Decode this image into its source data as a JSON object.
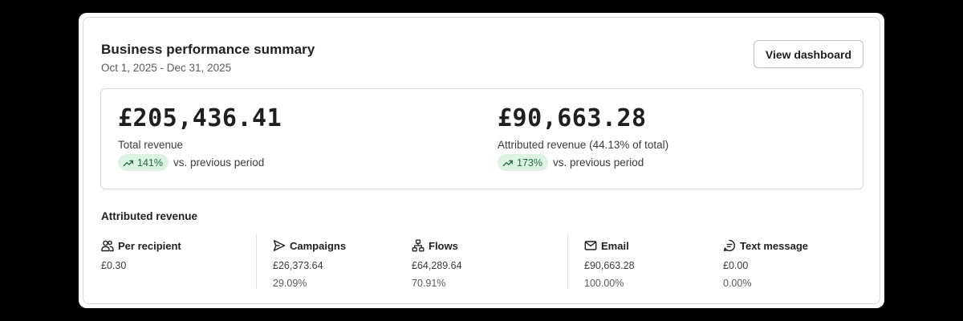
{
  "header": {
    "title": "Business performance summary",
    "date_range": "Oct 1, 2025 - Dec 31, 2025",
    "view_button": "View dashboard"
  },
  "summary": {
    "total": {
      "value": "£205,436.41",
      "label": "Total revenue",
      "change": "141%",
      "change_suffix": "vs. previous period",
      "trend_icon": "trend-up-icon"
    },
    "attributed": {
      "value": "£90,663.28",
      "label": "Attributed revenue (44.13% of total)",
      "change": "173%",
      "change_suffix": "vs. previous period",
      "trend_icon": "trend-up-icon"
    }
  },
  "attributed_section": {
    "title": "Attributed revenue",
    "stats": [
      {
        "label": "Per recipient",
        "icon": "people-icon",
        "value": "£0.30",
        "percent": ""
      },
      {
        "label": "Campaigns",
        "icon": "send-icon",
        "value": "£26,373.64",
        "percent": "29.09%"
      },
      {
        "label": "Flows",
        "icon": "flow-icon",
        "value": "£64,289.64",
        "percent": "70.91%"
      },
      {
        "label": "Email",
        "icon": "mail-icon",
        "value": "£90,663.28",
        "percent": "100.00%"
      },
      {
        "label": "Text message",
        "icon": "message-icon",
        "value": "£0.00",
        "percent": "0.00%"
      }
    ]
  },
  "colors": {
    "positive_pill_bg": "#dcf3e3",
    "positive_pill_text": "#1d6b3a"
  }
}
